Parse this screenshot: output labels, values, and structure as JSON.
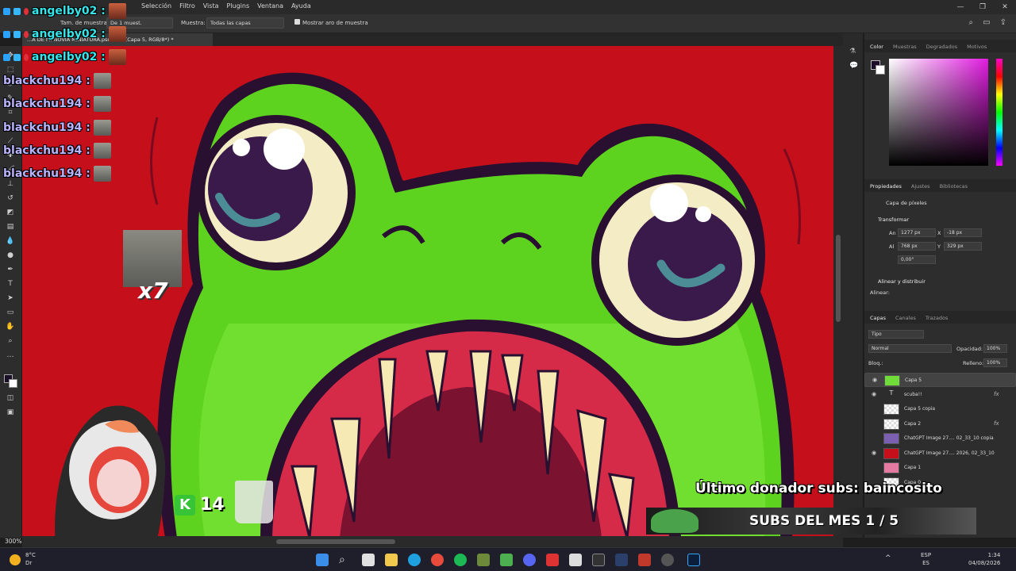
{
  "menubar": {
    "items": [
      "Selección",
      "Filtro",
      "Vista",
      "Plugins",
      "Ventana",
      "Ayuda"
    ],
    "window_controls": [
      "—",
      "❐",
      "✕"
    ]
  },
  "options": {
    "sample_size_label": "Tam. de muestra:",
    "sample_size_value": "De 1 muest.",
    "sample_label": "Muestra:",
    "sample_value": "Todas las capas",
    "show_ring_label": "Mostrar aro de muestra"
  },
  "document": {
    "tab_title": "...A DE MI NOVIA MINIATURA.psd al ... (Capa 5, RGB/8*) *",
    "zoom": "300%"
  },
  "color_panel": {
    "tabs": [
      "Color",
      "Muestras",
      "Degradados",
      "Motivos"
    ],
    "fg_color": "#1a0f26",
    "bg_color": "#ffffff"
  },
  "properties": {
    "tabs": [
      "Propiedades",
      "Ajustes",
      "Bibliotecas"
    ],
    "kind": "Capa de píxeles",
    "transform_label": "Transformar",
    "w_label": "An",
    "w_value": "1277 px",
    "h_label": "Al",
    "h_value": "768 px",
    "x_label": "X",
    "x_value": "-18 px",
    "y_label": "Y",
    "y_value": "329 px",
    "angle_value": "0,00°",
    "align_label": "Alinear y distribuir",
    "align_sub": "Alinear:"
  },
  "layers_panel": {
    "tabs": [
      "Capas",
      "Canales",
      "Trazados"
    ],
    "filter": "Tipo",
    "blend": "Normal",
    "opacity_label": "Opacidad:",
    "opacity_value": "100%",
    "lock_label": "Bloq.:",
    "fill_label": "Relleno:",
    "fill_value": "100%",
    "layers": [
      {
        "name": "Capa 5",
        "visible": true,
        "fx": false,
        "selected": true,
        "thumb": "#6fdc3a"
      },
      {
        "name": "scuba!!",
        "visible": true,
        "fx": true,
        "text": true
      },
      {
        "name": "Capa 5 copia",
        "visible": false,
        "fx": false
      },
      {
        "name": "Capa 2",
        "visible": false,
        "fx": true
      },
      {
        "name": "ChatGPT Image 27.... 02_33_10 copia",
        "visible": false,
        "fx": false,
        "thumb": "#7b5fb0"
      },
      {
        "name": "ChatGPT Image 27.... 2026, 02_33_10",
        "visible": true,
        "fx": false,
        "thumb": "#c5101b"
      },
      {
        "name": "Capa 1",
        "visible": false,
        "fx": false,
        "thumb": "#e57aa0"
      },
      {
        "name": "Capa 0",
        "visible": false,
        "fx": false
      }
    ]
  },
  "chat": [
    {
      "user": "angelby02 :",
      "color": "cyan"
    },
    {
      "user": "angelby02 :",
      "color": "cyan"
    },
    {
      "user": "angelby02 :",
      "color": "cyan"
    },
    {
      "user": "blackchu194 :",
      "color": "lav"
    },
    {
      "user": "blackchu194 :",
      "color": "lav"
    },
    {
      "user": "blackchu194 :",
      "color": "lav"
    },
    {
      "user": "blackchu194 :",
      "color": "lav"
    },
    {
      "user": "blackchu194 :",
      "color": "lav"
    }
  ],
  "overlay": {
    "combo": "x7",
    "donor_text": "Último donador subs: baincosito",
    "subs_text": "SUBS DEL MES 1 / 5",
    "k_badge": "K",
    "k_count": "14"
  },
  "taskbar": {
    "weather_temp": "8°C",
    "weather_sub": "Dr",
    "lang": "ESP",
    "lang_sub": "ES",
    "time": "1:34",
    "date": "04/08/2026"
  }
}
